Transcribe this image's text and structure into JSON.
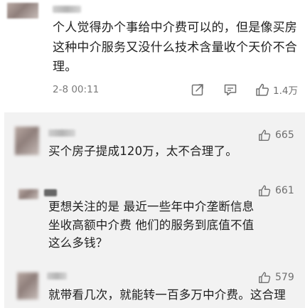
{
  "main_post": {
    "text": "个人觉得办个事给中介费可以的，但是像买房这种中介服务又没什么技术含量收个天价不合理。",
    "timestamp": "2-8 00:11",
    "likes": "1.4万"
  },
  "replies": [
    {
      "text": "买个房子提成120万，太不合理了。",
      "likes": "665"
    },
    {
      "text": "更想关注的是 最近一些年中介垄断信息 坐收高额中介费 他们的服务到底值不值这么多钱？",
      "likes": "661"
    },
    {
      "text": "就带看几次，就能转一百多万中介费。这合理",
      "likes": "579"
    }
  ],
  "icons": {
    "share": "share-icon",
    "comment": "comment-icon",
    "like": "thumbs-up-icon"
  }
}
